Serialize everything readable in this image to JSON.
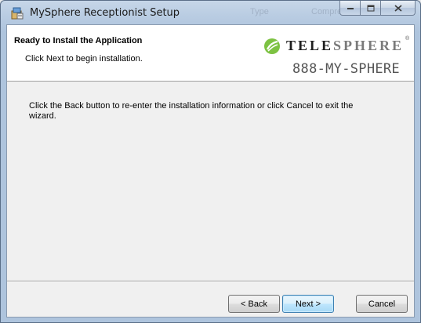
{
  "window": {
    "title": "MySphere Receptionist Setup",
    "ghost_title_fragments": [
      "Type",
      "Compre"
    ]
  },
  "header": {
    "title": "Ready to Install the Application",
    "subtitle": "Click Next to begin installation."
  },
  "logo": {
    "word_part1": "TELE",
    "word_part2": "SPHERE",
    "trademark": "®",
    "phone": "888-MY-SPHERE",
    "mark_color": "#7dc242"
  },
  "body": {
    "text": "Click the Back button to re-enter the installation information or click Cancel to exit the wizard."
  },
  "buttons": {
    "back_label": "< Back",
    "next_label": "Next >",
    "cancel_label": "Cancel"
  },
  "colors": {
    "accent_button_border": "#3c7fb1",
    "header_background": "#ffffff",
    "dialog_background": "#f0f0f0"
  }
}
